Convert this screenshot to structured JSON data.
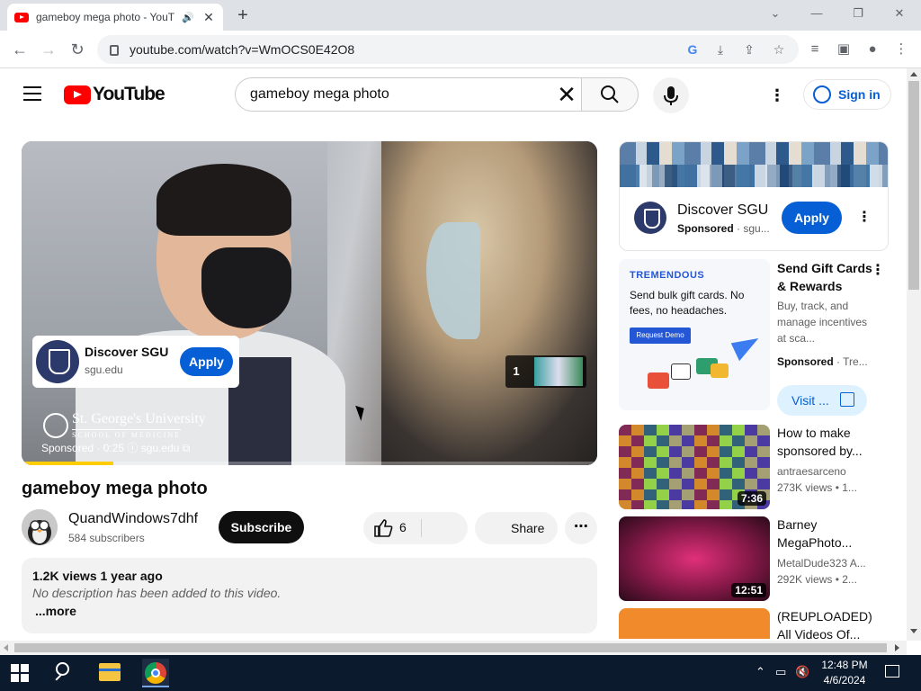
{
  "browser": {
    "tab_title": "gameboy mega photo - YouTube",
    "url": "youtube.com/watch?v=WmOCS0E42O8"
  },
  "youtube": {
    "logo_text": "YouTube",
    "search_value": "gameboy mega photo",
    "signin_label": "Sign in"
  },
  "player": {
    "ad_card": {
      "title": "Discover SGU",
      "domain": "sgu.edu",
      "apply_label": "Apply"
    },
    "ad_queue_count": "1",
    "brand_name": "St. George's University",
    "brand_sub": "SCHOOL OF MEDICINE",
    "sponsored_line": "Sponsored · 0:25 ⓘ  sgu.edu ⧉",
    "ad_progress": 0.16
  },
  "video": {
    "title": "gameboy mega photo",
    "channel_name": "QuandWindows7dhf",
    "subscribers": "584 subscribers",
    "subscribe_label": "Subscribe",
    "likes": "6",
    "share_label": "Share",
    "views_date": "1.2K views  1 year ago",
    "description": "No description has been added to this video.",
    "more_label": "...more"
  },
  "sidebar": {
    "banner": {
      "title": "Discover SGU",
      "sponsored": "Sponsored",
      "domain": "· sgu...",
      "apply_label": "Apply"
    },
    "ad2": {
      "brand": "TREMENDOUS",
      "copy": "Send bulk gift cards. No fees, no headaches.",
      "demo": "Request Demo",
      "title": "Send Gift Cards & Rewards",
      "description": "Buy, track, and manage incentives at sca...",
      "sponsored": "Sponsored",
      "advertiser": "· Tre...",
      "visit_label": "Visit ..."
    },
    "videos": [
      {
        "title": "How to make sponsored by...",
        "channel": "antraesarceno",
        "meta": "273K views  • 1...",
        "duration": "7:36"
      },
      {
        "title": "Barney MegaPhoto...",
        "channel": "MetalDude323 A...",
        "meta": "292K views  • 2...",
        "duration": "12:51"
      },
      {
        "title": "(REUPLOADED) All Videos Of...",
        "channel": "",
        "meta": "",
        "duration": ""
      }
    ]
  },
  "taskbar": {
    "time": "12:48 PM",
    "date": "4/6/2024"
  }
}
